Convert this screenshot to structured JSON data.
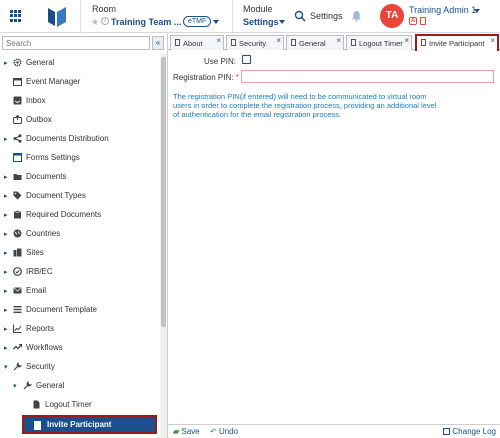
{
  "header": {
    "room_label": "Room",
    "room_value": "Training Team ...",
    "room_badge": "eTMF",
    "module_label": "Module",
    "module_value": "Settings",
    "settings_label": "Settings",
    "avatar_initials": "TA",
    "user_name": "Training Admin 1",
    "role_badge": "A",
    "accent_color": "#1a4f8b",
    "avatar_color": "#e8453c"
  },
  "sidebar": {
    "search_placeholder": "Search",
    "collapse_icon": "double-chevron-left-icon",
    "items": [
      {
        "label": "General",
        "icon": "gear-icon",
        "arrow": "▸"
      },
      {
        "label": "Event Manager",
        "icon": "calendar-icon",
        "arrow": ""
      },
      {
        "label": "Inbox",
        "icon": "inbox-icon",
        "arrow": ""
      },
      {
        "label": "Outbox",
        "icon": "outbox-icon",
        "arrow": ""
      },
      {
        "label": "Documents Distribution",
        "icon": "share-icon",
        "arrow": "▸"
      },
      {
        "label": "Forms Settings",
        "icon": "form-icon",
        "arrow": ""
      },
      {
        "label": "Documents",
        "icon": "folder-icon",
        "arrow": "▸"
      },
      {
        "label": "Document Types",
        "icon": "tag-icon",
        "arrow": "▸"
      },
      {
        "label": "Required Documents",
        "icon": "clipboard-icon",
        "arrow": "▸"
      },
      {
        "label": "Countries",
        "icon": "globe-icon",
        "arrow": "▸"
      },
      {
        "label": "Sites",
        "icon": "building-icon",
        "arrow": "▸"
      },
      {
        "label": "IRB/EC",
        "icon": "check-circle-icon",
        "arrow": "▸"
      },
      {
        "label": "Email",
        "icon": "envelope-icon",
        "arrow": "▸"
      },
      {
        "label": "Document Template",
        "icon": "list-icon",
        "arrow": "▸"
      },
      {
        "label": "Reports",
        "icon": "chart-icon",
        "arrow": "▸"
      },
      {
        "label": "Workflows",
        "icon": "workflow-icon",
        "arrow": "▸"
      },
      {
        "label": "Security",
        "icon": "wrench-icon",
        "arrow": "▾"
      },
      {
        "label": "General",
        "icon": "wrench-icon",
        "arrow": "▾"
      },
      {
        "label": "Logout Timer",
        "icon": "document-icon",
        "arrow": ""
      }
    ],
    "selected_label": "Invite Participant"
  },
  "tabs": [
    {
      "label": "About"
    },
    {
      "label": "Security"
    },
    {
      "label": "General"
    },
    {
      "label": "Logout Timer"
    },
    {
      "label": "Invite Participant"
    }
  ],
  "form": {
    "use_pin_label": "Use PIN:",
    "reg_pin_label": "Registration PIN:",
    "reg_pin_required": "*",
    "reg_pin_value": "",
    "note": "The registration PIN(if entered) will need to be communicated to virtual room users in order to complete the registration process, providing an additional level of authentication for the email registration process."
  },
  "footer": {
    "save_label": "Save",
    "undo_label": "Undo",
    "change_log_label": "Change Log"
  }
}
